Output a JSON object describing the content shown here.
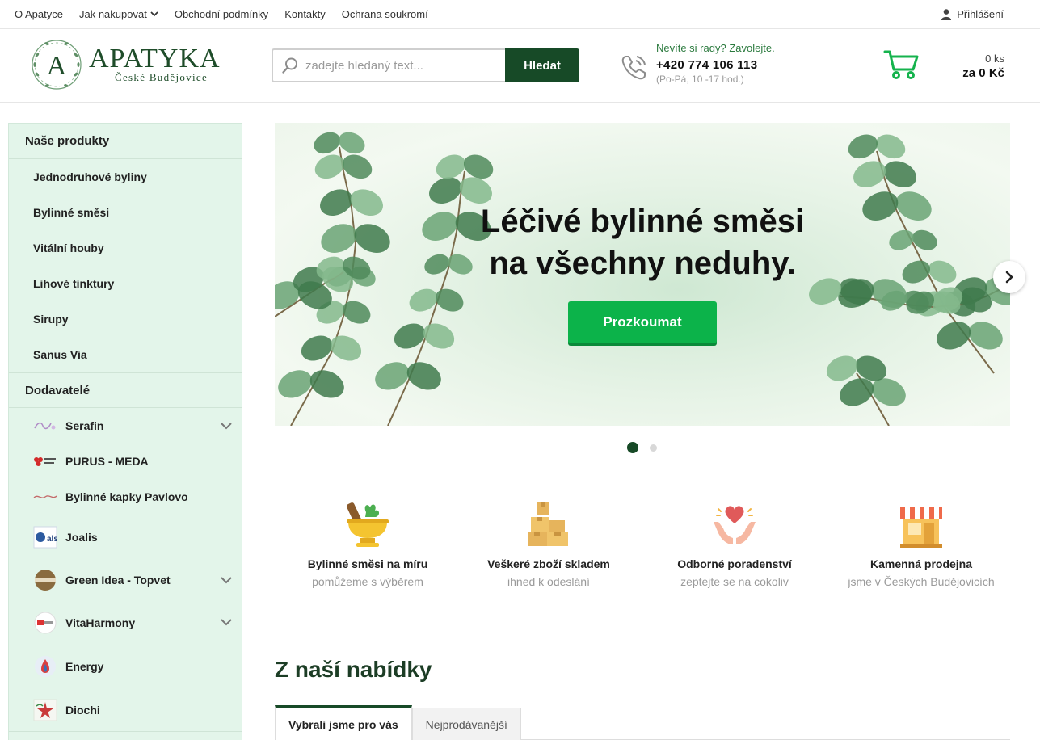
{
  "topbar": {
    "links": [
      "O Apatyce",
      "Jak nakupovat",
      "Obchodní podmínky",
      "Kontakty",
      "Ochrana soukromí"
    ],
    "login_label": "Přihlášení"
  },
  "header": {
    "logo_name": "APATYKA",
    "logo_initial": "A",
    "logo_city": "České Budějovice",
    "search": {
      "placeholder": "zadejte hledaný text...",
      "value": "",
      "button_label": "Hledat"
    },
    "contact": {
      "question": "Nevíte si rady? Zavolejte.",
      "phone": "+420 774 106 113",
      "hours": "(Po-Pá, 10 -17 hod.)"
    },
    "cart": {
      "count": "0 ks",
      "total": "za 0 Kč"
    }
  },
  "sidebar": {
    "products_heading": "Naše produkty",
    "products": [
      "Jednodruhové byliny",
      "Bylinné směsi",
      "Vitální houby",
      "Lihové tinktury",
      "Sirupy",
      "Sanus Via"
    ],
    "suppliers_heading": "Dodavatelé",
    "suppliers": [
      {
        "label": "Serafin",
        "expandable": true
      },
      {
        "label": "PURUS - MEDA",
        "expandable": false
      },
      {
        "label": "Bylinné kapky Pavlovo",
        "expandable": false
      },
      {
        "label": "Joalis",
        "expandable": false
      },
      {
        "label": "Green Idea - Topvet",
        "expandable": true
      },
      {
        "label": "VitaHarmony",
        "expandable": true
      },
      {
        "label": "Energy",
        "expandable": false
      },
      {
        "label": "Diochi",
        "expandable": false
      }
    ]
  },
  "hero": {
    "title_line1": "Léčivé bylinné směsi",
    "title_line2": "na všechny neduhy.",
    "button_label": "Prozkoumat",
    "active_slide": 1,
    "slide_count": 2
  },
  "benefits": [
    {
      "title": "Bylinné směsi na míru",
      "subtitle": "pomůžeme s výběrem",
      "icon": "mortar-herbs-icon"
    },
    {
      "title": "Veškeré zboží skladem",
      "subtitle": "ihned k odeslání",
      "icon": "boxes-icon"
    },
    {
      "title": "Odborné poradenství",
      "subtitle": "zeptejte se na cokoliv",
      "icon": "heart-hands-icon"
    },
    {
      "title": "Kamenná prodejna",
      "subtitle": "jsme v Českých Budějovicích",
      "icon": "storefront-icon"
    }
  ],
  "offer": {
    "title": "Z naší nabídky",
    "tabs": [
      "Vybrali jsme pro vás",
      "Nejprodávanější"
    ],
    "active_tab": 0
  },
  "colors": {
    "brand_dark_green": "#174a27",
    "cta_green": "#0cb34a",
    "sidebar_bg": "#e3f5ea"
  }
}
